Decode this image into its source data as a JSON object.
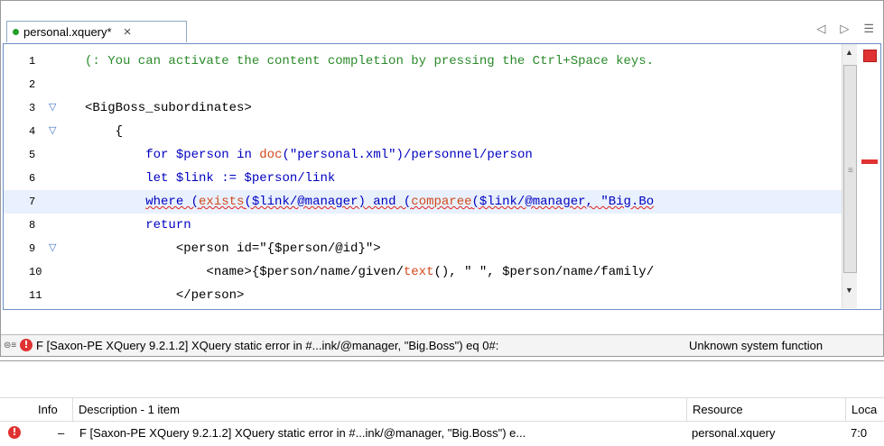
{
  "editor_tab": {
    "title": "personal.xquery*",
    "close_icon": "×",
    "nav_prev": "◁",
    "nav_next": "▷",
    "nav_menu": "☰"
  },
  "code_lines": [
    {
      "num": "1",
      "fold": "",
      "current": false,
      "tokens": [
        {
          "t": "(: You can activate the content completion by pressing the Ctrl+Space keys.",
          "c": "c-comment"
        }
      ]
    },
    {
      "num": "2",
      "fold": "",
      "current": false,
      "tokens": []
    },
    {
      "num": "3",
      "fold": "▽",
      "current": false,
      "tokens": [
        {
          "t": "<BigBoss_subordinates>",
          "c": "c-tag"
        }
      ]
    },
    {
      "num": "4",
      "fold": "▽",
      "current": false,
      "tokens": [
        {
          "t": "    {",
          "c": "c-plain"
        }
      ]
    },
    {
      "num": "5",
      "fold": "",
      "current": false,
      "tokens": [
        {
          "t": "        ",
          "c": "c-plain"
        },
        {
          "t": "for",
          "c": "c-kw"
        },
        {
          "t": " $person ",
          "c": "c-kw"
        },
        {
          "t": "in",
          "c": "c-kw"
        },
        {
          "t": " ",
          "c": "c-plain"
        },
        {
          "t": "doc",
          "c": "c-fn"
        },
        {
          "t": "(\"personal.xml\")/personnel/person",
          "c": "c-kw"
        }
      ]
    },
    {
      "num": "6",
      "fold": "",
      "current": false,
      "tokens": [
        {
          "t": "        ",
          "c": "c-plain"
        },
        {
          "t": "let $link := $person/link",
          "c": "c-kw"
        }
      ]
    },
    {
      "num": "7",
      "fold": "",
      "current": true,
      "tokens": [
        {
          "t": "        ",
          "c": "c-plain"
        },
        {
          "t": "where (",
          "c": "c-kw squiggle"
        },
        {
          "t": "exists",
          "c": "c-fn squiggle"
        },
        {
          "t": "($link/@manager) and (",
          "c": "c-kw squiggle"
        },
        {
          "t": "comparee",
          "c": "c-fn squiggle"
        },
        {
          "t": "($link/@manager, \"Big.Bo",
          "c": "c-kw squiggle"
        }
      ]
    },
    {
      "num": "8",
      "fold": "",
      "current": false,
      "tokens": [
        {
          "t": "        ",
          "c": "c-plain"
        },
        {
          "t": "return",
          "c": "c-kw"
        }
      ]
    },
    {
      "num": "9",
      "fold": "▽",
      "current": false,
      "tokens": [
        {
          "t": "            ",
          "c": "c-plain"
        },
        {
          "t": "<person id=\"{$person/@id}\">",
          "c": "c-tag"
        }
      ]
    },
    {
      "num": "10",
      "fold": "",
      "current": false,
      "tokens": [
        {
          "t": "                ",
          "c": "c-plain"
        },
        {
          "t": "<name>{$person/name/given/",
          "c": "c-tag"
        },
        {
          "t": "text",
          "c": "c-fn"
        },
        {
          "t": "(), \" \", $person/name/family/",
          "c": "c-tag"
        }
      ]
    },
    {
      "num": "11",
      "fold": "",
      "current": false,
      "tokens": [
        {
          "t": "            ",
          "c": "c-plain"
        },
        {
          "t": "</person>",
          "c": "c-tag"
        }
      ]
    }
  ],
  "status_bar": {
    "text": "F [Saxon-PE XQuery 9.2.1.2] XQuery static error in #...ink/@manager, \"Big.Boss\") eq 0#:",
    "message": "Unknown system function"
  },
  "problems": {
    "columns": [
      "Info",
      "Description - 1 item",
      "Resource",
      "Loca"
    ],
    "rows": [
      {
        "info": "–",
        "description": "F [Saxon-PE XQuery 9.2.1.2] XQuery static error in #...ink/@manager, \"Big.Boss\") e...",
        "resource": "personal.xquery",
        "location": "7:0"
      }
    ]
  },
  "colors": {
    "error_red": "#e03232",
    "comment_green": "#2a8a2a",
    "keyword_blue": "#0000c0",
    "function_orange": "#d2491a",
    "current_line": "#e8f1fd"
  }
}
